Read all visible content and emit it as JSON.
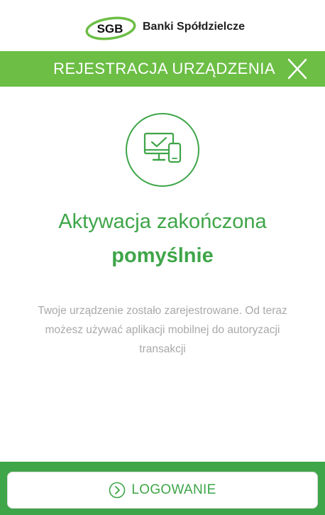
{
  "brand": {
    "logo_short": "SGB",
    "name": "Banki Spółdzielcze"
  },
  "titlebar": {
    "title": "REJESTRACJA URZĄDZENIA",
    "close_icon": "close-icon"
  },
  "main": {
    "icon": "device-registered-icon",
    "headline": "Aktywacja zakończona",
    "headline_strong": "pomyślnie",
    "message": "Twoje urządzenie zostało zarejestrowane. Od teraz możesz używać aplikacji mobilnej do autoryzacji transakcji"
  },
  "footer": {
    "login_label": "LOGOWANIE",
    "login_icon": "chevron-right-circle-icon"
  },
  "colors": {
    "titlebar_green": "#6cbe45",
    "primary_green": "#3ea548",
    "text_gray": "#a9a9a9"
  }
}
